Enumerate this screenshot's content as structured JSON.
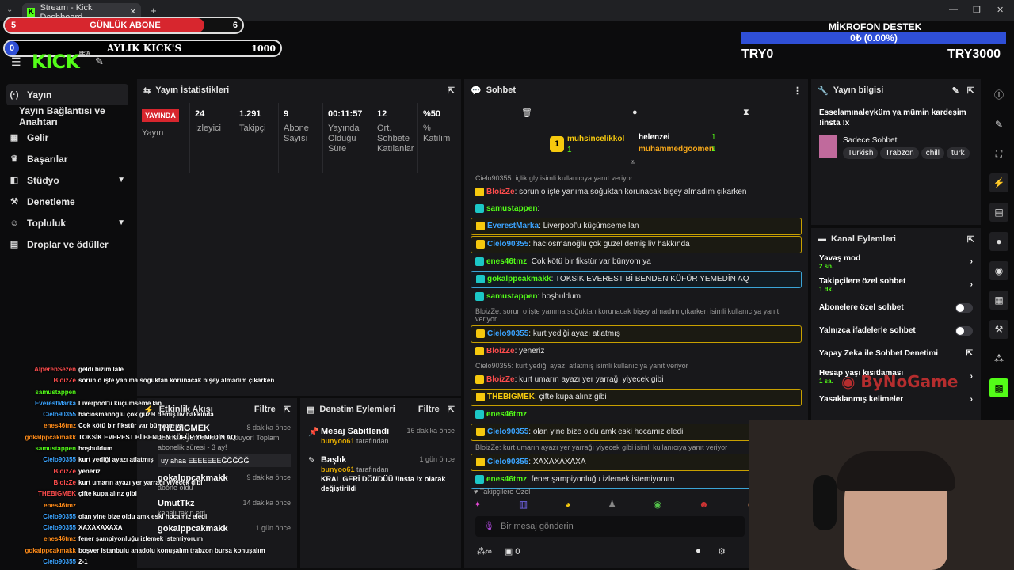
{
  "browser": {
    "tab_title": "Stream - Kick Dashboard",
    "new_tab": "+",
    "window_controls": [
      "—",
      "❐",
      "✕"
    ]
  },
  "overlay_goals": {
    "daily_subs": {
      "label": "GÜNLÜK ABONE",
      "current": "5",
      "target": "6",
      "progress": 0.84
    },
    "monthly_kicks": {
      "label": "AYLIK KICK'S",
      "current": "0",
      "target": "1000",
      "progress": 0.0
    },
    "mic_support": {
      "title": "MİKROFON DESTEK",
      "bar_text": "0₺ (0.00%)",
      "left_amount": "TRY0",
      "right_amount": "TRY3000"
    }
  },
  "brand": {
    "logo": "KICK",
    "beta": "BETA"
  },
  "sidebar": {
    "items": [
      {
        "label": "Yayın",
        "icon": "broadcast-icon"
      },
      {
        "label": "Yayın Bağlantısı ve Anahtarı",
        "icon": ""
      },
      {
        "label": "Gelir",
        "icon": "revenue-icon"
      },
      {
        "label": "Başarılar",
        "icon": "trophy-icon"
      },
      {
        "label": "Stüdyo",
        "icon": "studio-icon"
      },
      {
        "label": "Denetleme",
        "icon": "wrench-icon"
      },
      {
        "label": "Topluluk",
        "icon": "community-icon"
      },
      {
        "label": "Droplar ve ödüller",
        "icon": "drops-icon"
      }
    ]
  },
  "stats_panel": {
    "title": "Yayın İstatistikleri",
    "live_badge": "YAYINDA",
    "columns": [
      {
        "value": "",
        "label": "Yayın"
      },
      {
        "value": "24",
        "label": "İzleyici"
      },
      {
        "value": "1.291",
        "label": "Takipçi"
      },
      {
        "value": "9",
        "label": "Abone Sayısı"
      },
      {
        "value": "00:11:57",
        "label": "Yayında Olduğu Süre"
      },
      {
        "value": "12",
        "label": "Ort. Sohbete Katılanlar"
      },
      {
        "value": "%50",
        "label": "% Katılım"
      }
    ]
  },
  "activity_panel": {
    "title": "Etkinlik Akışı",
    "filter": "Filtre",
    "items": [
      {
        "name": "THEBIGMEK",
        "time": "8 dakika önce",
        "sub": "abonelik yenilemesini kutluyor! Toplam abonelik süresi - 3 ay!",
        "message": "uy ahaa EEEEEEEĞĞĞĞĞ"
      },
      {
        "name": "gokalppcakmakk",
        "time": "9 dakika önce",
        "sub": "abone oldu",
        "message": ""
      },
      {
        "name": "UmutTkz",
        "time": "14 dakika önce",
        "sub": "kanalı takip etti",
        "message": ""
      },
      {
        "name": "gokalppcakmakk",
        "time": "1 gün önce",
        "sub": "",
        "message": ""
      }
    ]
  },
  "mod_panel": {
    "title": "Denetim Eylemleri",
    "filter": "Filtre",
    "items": [
      {
        "title": "Mesaj Sabitlendi",
        "time": "16 dakika önce",
        "by": "bunyoo61",
        "by_suffix": "tarafından",
        "detail": ""
      },
      {
        "title": "Başlık",
        "time": "1 gün önce",
        "by": "bunyoo61",
        "by_suffix": "tarafından",
        "detail": "KRAL GERİ DÖNDÜÜ !insta !x olarak değiştirildi"
      }
    ]
  },
  "chat_panel": {
    "title": "Sohbet",
    "leaders": [
      {
        "rank": "1",
        "name": "muhsincelikkol",
        "count": "1"
      },
      {
        "rank": "",
        "name": "helenzei",
        "count": "1"
      },
      {
        "rank": "",
        "name": "muhammedgoomen",
        "count": "1"
      }
    ],
    "messages": [
      {
        "reply": "Cielo90355: içlik gly isimli kullanıcıya yanıt veriyor",
        "user": "BloizZe",
        "text": ": sorun o işte yanıma soğuktan korunacak bişey almadım çıkarken",
        "color": "#ff4d4d",
        "style": ""
      },
      {
        "reply": "",
        "user": "samustappen",
        "text": ": ",
        "color": "#53fc18",
        "style": ""
      },
      {
        "reply": "",
        "user": "EverestMarka",
        "text": ": Liverpool'u küçümseme lan",
        "color": "#3ba4ff",
        "style": "hl"
      },
      {
        "reply": "",
        "user": "Cielo90355",
        "text": ": hacıosmanoğlu çok güzel demiş liv hakkında",
        "color": "#3ba4ff",
        "style": "hl"
      },
      {
        "reply": "",
        "user": "enes46tmz",
        "text": ": Cok kötü bir fikstür var bünyom ya",
        "color": "#53fc18",
        "style": ""
      },
      {
        "reply": "",
        "user": "gokalppcakmakk",
        "text": ": TOKSİK EVEREST Bİ BENDEN KÜFÜR YEMEDİN AQ",
        "color": "#53fc18",
        "style": "hl2"
      },
      {
        "reply": "",
        "user": "samustappen",
        "text": ": hoşbuldum",
        "color": "#53fc18",
        "style": ""
      },
      {
        "reply": "BloizZe: sorun o işte yanıma soğuktan korunacak bişey almadım çıkarken isimli kullanıcıya yanıt veriyor",
        "user": "Cielo90355",
        "text": ": kurt yediği ayazı atlatmış",
        "color": "#3ba4ff",
        "style": "hl"
      },
      {
        "reply": "",
        "user": "BloizZe",
        "text": ": yeneriz",
        "color": "#ff4d4d",
        "style": ""
      },
      {
        "reply": "Cielo90355: kurt yediği ayazı atlatmış isimli kullanıcıya yanıt veriyor",
        "user": "BloizZe",
        "text": ": kurt umarın ayazı yer yarrağı yiyecek gibi",
        "color": "#ff4d4d",
        "style": ""
      },
      {
        "reply": "",
        "user": "THEBIGMEK",
        "text": ": çifte kupa alınz gibi",
        "color": "#f6c90e",
        "style": "hl"
      },
      {
        "reply": "",
        "user": "enes46tmz",
        "text": ": ",
        "color": "#53fc18",
        "style": ""
      },
      {
        "reply": "",
        "user": "Cielo90355",
        "text": ": olan yine bize oldu amk eski hocamız eledi",
        "color": "#3ba4ff",
        "style": "hl"
      },
      {
        "reply": "BloizZe: kurt umarın ayazı yer yarrağı yiyecek gibi isimli kullanıcıya yanıt veriyor",
        "user": "Cielo90355",
        "text": ": XAXAXAXAXA",
        "color": "#3ba4ff",
        "style": "hl"
      },
      {
        "reply": "",
        "user": "enes46tmz",
        "text": ": fener şampiyonluğu izlemek istemiyorum",
        "color": "#53fc18",
        "style": ""
      },
      {
        "reply": "",
        "user": "gokalppcakmakk",
        "text": ": boşver istanbulu anadolu konuşalım trabzon bursa konu",
        "color": "#53fc18",
        "style": "hl2"
      },
      {
        "reply": "",
        "user": "Cielo90355",
        "text": ": 2-1",
        "color": "#3ba4ff",
        "style": "hl"
      }
    ],
    "follower_label": "Takipçilere Özel",
    "input_placeholder": "Bir mesaj gönderin",
    "footer_count": "0"
  },
  "stream_info": {
    "title": "Yayın bilgisi",
    "stream_title": "Esselamınaleyküm ya mümin kardeşim !insta !x",
    "category": "Sadece Sohbet",
    "tags": [
      "Turkish",
      "Trabzon",
      "chill",
      "türk"
    ]
  },
  "channel_actions": {
    "title": "Kanal Eylemleri",
    "rows": [
      {
        "label": "Yavaş mod",
        "sub": "2 sn.",
        "control": "chevron"
      },
      {
        "label": "Takipçilere özel sohbet",
        "sub": "1 dk.",
        "control": "chevron"
      },
      {
        "label": "Abonelere özel sohbet",
        "sub": "",
        "control": "toggle"
      },
      {
        "label": "Yalnızca ifadelerle sohbet",
        "sub": "",
        "control": "toggle"
      },
      {
        "label": "Yapay Zeka ile Sohbet Denetimi",
        "sub": "",
        "control": "external"
      },
      {
        "label": "Hesap yaşı kısıtlaması",
        "sub": "1 sa.",
        "control": "chevron"
      },
      {
        "label": "Yasaklanmış kelimeler",
        "sub": "",
        "control": "chevron"
      }
    ]
  },
  "overlay_chat": [
    {
      "user": "AlperenSezen",
      "text": "geldi bizim lale",
      "color": "#ff4d4d"
    },
    {
      "user": "BloizZe",
      "text": "sorun o işte yanıma soğuktan korunacak bişey almadım çıkarken",
      "color": "#ff4d4d"
    },
    {
      "user": "samustappen",
      "text": "",
      "color": "#53fc18"
    },
    {
      "user": "EverestMarka",
      "text": "Liverpool'u küçümseme lan",
      "color": "#3ba4ff"
    },
    {
      "user": "Cielo90355",
      "text": "hacıosmanoğlu çok güzel demiş liv hakkında",
      "color": "#3ba4ff"
    },
    {
      "user": "enes46tmz",
      "text": "Cok kötü bir fikstür var bünyom ya",
      "color": "#ff8c1a"
    },
    {
      "user": "gokalppcakmakk",
      "text": "TOKSİK EVEREST Bİ BENDEN KÜFÜR YEMEDİN AQ",
      "color": "#ff8c1a"
    },
    {
      "user": "samustappen",
      "text": "hoşbuldum",
      "color": "#53fc18"
    },
    {
      "user": "Cielo90355",
      "text": "kurt yediği ayazı atlatmış",
      "color": "#3ba4ff"
    },
    {
      "user": "BloizZe",
      "text": "yeneriz",
      "color": "#ff4d4d"
    },
    {
      "user": "BloizZe",
      "text": "kurt umarın ayazı yer yarrağı yiyecek gibi",
      "color": "#ff4d4d"
    },
    {
      "user": "THEBIGMEK",
      "text": "çifte kupa alınz gibi",
      "color": "#ff4d4d"
    },
    {
      "user": "enes46tmz",
      "text": "",
      "color": "#ff8c1a"
    },
    {
      "user": "Cielo90355",
      "text": "olan yine bize oldu amk eski hocamız eledi",
      "color": "#3ba4ff"
    },
    {
      "user": "Cielo90355",
      "text": "XAXAXAXAXA",
      "color": "#3ba4ff"
    },
    {
      "user": "enes46tmz",
      "text": "fener şampiyonluğu izlemek istemiyorum",
      "color": "#ff8c1a"
    },
    {
      "user": "gokalppcakmakk",
      "text": "boşver istanbulu anadolu konuşalım trabzon bursa konuşalım",
      "color": "#ff8c1a"
    },
    {
      "user": "Cielo90355",
      "text": "2-1",
      "color": "#3ba4ff"
    }
  ],
  "watermark": "ByNoGame",
  "colors": {
    "accent": "#53fc18",
    "live": "#d7262e",
    "mic_bar": "#2f4fd6",
    "highlight_gold": "#c8a000",
    "highlight_blue": "#3ba4d6"
  }
}
